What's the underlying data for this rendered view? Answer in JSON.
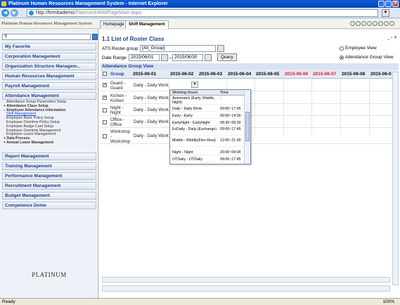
{
  "window": {
    "title": "Platinum Human Resources Management System - Internet Explorer",
    "minimize": "_",
    "maximize": "□",
    "close": "✕"
  },
  "address": {
    "host": "http://hrmbademo",
    "path": "/PlatinumHRM/PageMain.aspx"
  },
  "header": {
    "brand": "Platinum Human Resources Management System",
    "tabs": [
      "Homepage",
      "Shift Management"
    ]
  },
  "sidebar": {
    "search_placeholder": "",
    "menus": [
      "My Favorite",
      "Corporation Management",
      "Organization Structure Managem...",
      "Human Resources Management",
      "Payroll Management",
      "Attendance Management",
      "Report Management",
      "Training Management",
      "Performance Management",
      "Recruitment Management",
      "Budget Management",
      "Competence Dome"
    ],
    "attendance_items": [
      "Attendance Group Parameters Setup",
      "+ Attendance Class Setup",
      "− Employee Attendance Information",
      "Shift Management",
      "Employee Basic Policy Setup",
      "Employee Overtime Policy Setup",
      "Employee Badge Card Setup",
      "Employee Overtime Management",
      "Employee Leave Management",
      "+ Data Process",
      "+ Annual Leave Management"
    ],
    "logo": "PLATINUM"
  },
  "main": {
    "title": "1.1 List of Roster Class",
    "roster_group_label": "ATS Roster group",
    "roster_group_value": "[All_Group]",
    "date_range_label": "Date Range",
    "date_from": "2015/06/01",
    "date_to": "2015/06/30",
    "query_label": "Query",
    "employee_view": "Employee View",
    "attendance_group_view": "Attendance Group View",
    "section_title": "Attendance Group View",
    "grid": {
      "group_header": "Group",
      "dates": [
        "2015-06-01",
        "2015-06-02",
        "2015-06-03",
        "2015-06-04",
        "2015-06-05",
        "2015-06-06",
        "2015-06-07",
        "2015-06-08",
        "2015-06-0"
      ],
      "weekend_color": "#e01818",
      "rows": [
        {
          "group": "Guard - Guard",
          "checked": true,
          "work": "Daily - Daily Work"
        },
        {
          "group": "Kichen - Kichen",
          "checked": true,
          "work": "Daily - Daily Work"
        },
        {
          "group": "Night - Night",
          "checked": false,
          "work": "Daily - Daily Work"
        },
        {
          "group": "Office - Office",
          "checked": false,
          "work": "Daily - Daily Work"
        },
        {
          "group": "Workshop - Workshop",
          "checked": false,
          "work": "Daily - Daily Work"
        }
      ]
    },
    "popup": {
      "col_hours": "Working Hours",
      "col_time": "Time",
      "rows": [
        {
          "name": "Automatch (Early, Middle, Night)",
          "time": "-"
        },
        {
          "name": "Daily - Daily Work",
          "time": "09:00~17:45"
        },
        {
          "name": "Early - Early",
          "time": "06:00~14:00"
        },
        {
          "name": "EarlyNight - EarlyNight",
          "time": "08:30~09:30"
        },
        {
          "name": "ExDaily - Daily (Exchange)",
          "time": "09:00~17:45"
        },
        {
          "name": "Middle - Middle(Flex Rest)",
          "time": "12:00~21:00"
        },
        {
          "name": "Night - Night",
          "time": "20:00~04:00"
        },
        {
          "name": "OTDaily - OTDaily",
          "time": "09:00~17:45"
        }
      ]
    }
  },
  "status": {
    "left": "Ready",
    "zoom": "100%"
  }
}
